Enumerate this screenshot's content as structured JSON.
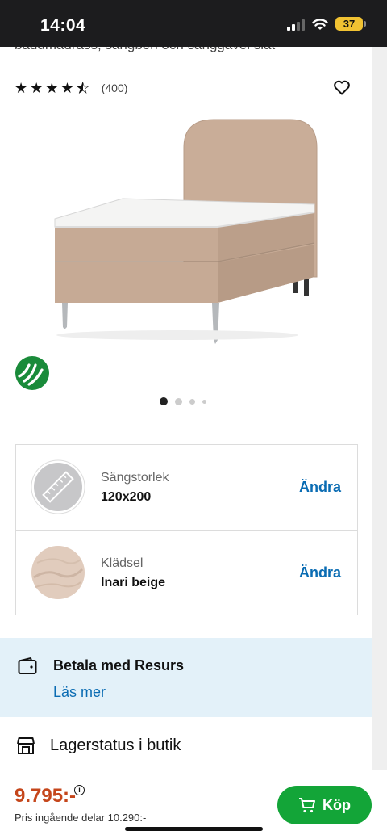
{
  "status_bar": {
    "time": "14:04",
    "battery": "37"
  },
  "product": {
    "subtitle_cut": "bäddmadrass, sängben och sänggavel slät",
    "rating_count": "(400)",
    "rating_stars": 4.5,
    "image_count": 4,
    "active_image": 1
  },
  "options": [
    {
      "label": "Sängstorlek",
      "value": "120x200",
      "action": "Ändra",
      "thumb": "size-icon"
    },
    {
      "label": "Klädsel",
      "value": "Inari beige",
      "action": "Ändra",
      "thumb": "fabric-swatch"
    }
  ],
  "resurs": {
    "title": "Betala med Resurs",
    "link": "Läs mer"
  },
  "stock": {
    "label": "Lagerstatus i butik"
  },
  "purchase": {
    "price": "9.795:-",
    "note": "Pris ingående delar 10.290:-",
    "buy_label": "Köp"
  },
  "colors": {
    "accent_blue": "#0a6cb3",
    "price_orange": "#c5461b",
    "buy_green": "#13a538",
    "resurs_bg": "#e3f1f9"
  }
}
